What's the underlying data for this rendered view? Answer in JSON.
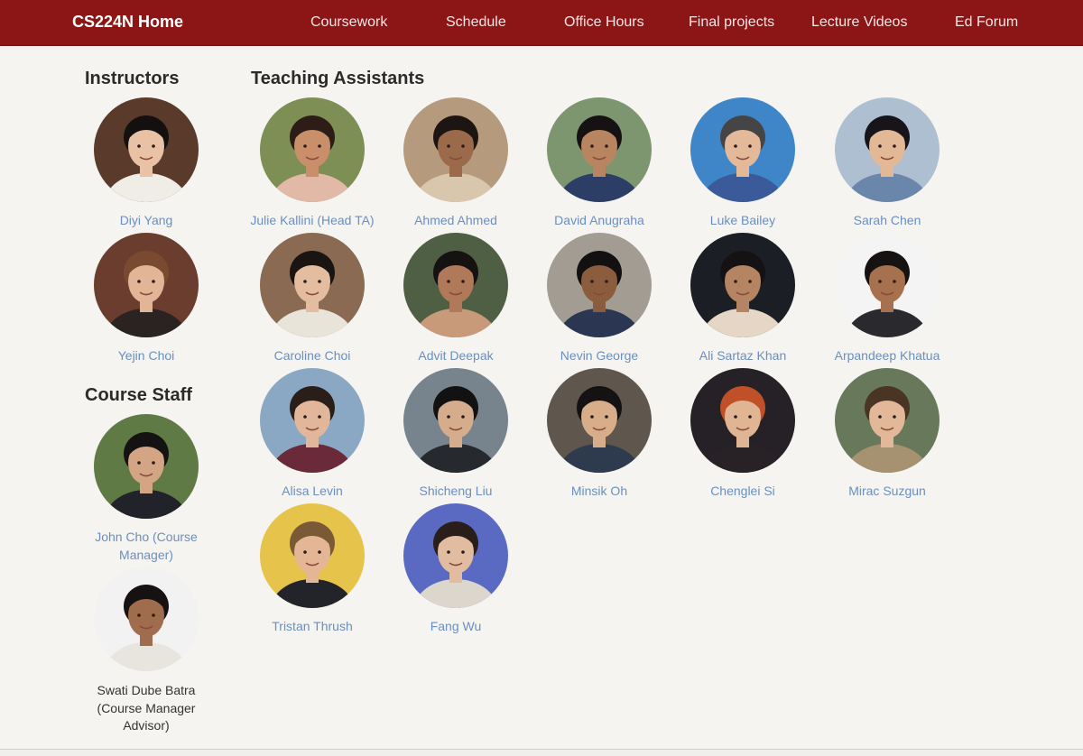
{
  "nav": {
    "brand": "CS224N Home",
    "links": [
      "Coursework",
      "Schedule",
      "Office Hours",
      "Final projects",
      "Lecture Videos",
      "Ed Forum"
    ]
  },
  "sections": {
    "instructors": "Instructors",
    "tas": "Teaching Assistants",
    "staff": "Course Staff"
  },
  "instructors": [
    {
      "name": "Diyi Yang",
      "palette": {
        "bg": "#5a3a2a",
        "skin": "#e9c2a6",
        "hair": "#141010",
        "shirt": "#f0ece6"
      }
    },
    {
      "name": "Yejin Choi",
      "palette": {
        "bg": "#6b3d2e",
        "skin": "#e2b596",
        "hair": "#7a4a30",
        "shirt": "#2a2322"
      }
    }
  ],
  "tas": [
    {
      "name": "Julie Kallini (Head TA)",
      "palette": {
        "bg": "#7d8f55",
        "skin": "#c98f6a",
        "hair": "#2d1d16",
        "shirt": "#e2b9a6"
      }
    },
    {
      "name": "Ahmed Ahmed",
      "palette": {
        "bg": "#b69a7e",
        "skin": "#9b6a4a",
        "hair": "#1d1512",
        "shirt": "#d9c7ad"
      }
    },
    {
      "name": "David Anugraha",
      "palette": {
        "bg": "#7e9670",
        "skin": "#b98560",
        "hair": "#161214",
        "shirt": "#2d3e66"
      }
    },
    {
      "name": "Luke Bailey",
      "palette": {
        "bg": "#3f86c9",
        "skin": "#e4b99a",
        "hair": "#454545",
        "shirt": "#3a5a9a"
      }
    },
    {
      "name": "Sarah Chen",
      "palette": {
        "bg": "#aebfd2",
        "skin": "#e2b896",
        "hair": "#17141a",
        "shirt": "#6a86aa"
      }
    },
    {
      "name": "Caroline Choi",
      "palette": {
        "bg": "#8a6a52",
        "skin": "#e4bca0",
        "hair": "#1a1412",
        "shirt": "#e8e4da"
      }
    },
    {
      "name": "Advit Deepak",
      "palette": {
        "bg": "#4f5f44",
        "skin": "#b07a5a",
        "hair": "#161212",
        "shirt": "#c99a7a"
      }
    },
    {
      "name": "Nevin George",
      "palette": {
        "bg": "#a29c92",
        "skin": "#8b5c3e",
        "hair": "#121010",
        "shirt": "#2a3652"
      }
    },
    {
      "name": "Ali Sartaz Khan",
      "palette": {
        "bg": "#1c1e26",
        "skin": "#b58462",
        "hair": "#141212",
        "shirt": "#e6d6c6"
      }
    },
    {
      "name": "Arpandeep Khatua",
      "palette": {
        "bg": "#f4f4f4",
        "skin": "#a7714f",
        "hair": "#161212",
        "shirt": "#2a2a2e"
      }
    },
    {
      "name": "Alisa Levin",
      "palette": {
        "bg": "#8aa8c4",
        "skin": "#e2b69a",
        "hair": "#2a1e18",
        "shirt": "#6a2a3a"
      }
    },
    {
      "name": "Shicheng Liu",
      "palette": {
        "bg": "#77848e",
        "skin": "#d6ad8c",
        "hair": "#131212",
        "shirt": "#26292e"
      }
    },
    {
      "name": "Minsik Oh",
      "palette": {
        "bg": "#5f574e",
        "skin": "#d8ad8a",
        "hair": "#141212",
        "shirt": "#2e3a4e"
      }
    },
    {
      "name": "Chenglei Si",
      "palette": {
        "bg": "#262126",
        "skin": "#e0b594",
        "hair": "#c05028",
        "shirt": "#282226"
      }
    },
    {
      "name": "Mirac Suzgun",
      "palette": {
        "bg": "#67795a",
        "skin": "#e2b898",
        "hair": "#4a3424",
        "shirt": "#a69270"
      }
    },
    {
      "name": "Tristan Thrush",
      "palette": {
        "bg": "#e6c44c",
        "skin": "#e4b696",
        "hair": "#7a5a36",
        "shirt": "#22242a"
      }
    },
    {
      "name": "Fang Wu",
      "palette": {
        "bg": "#5a6ac2",
        "skin": "#e2bca0",
        "hair": "#2a1e1a",
        "shirt": "#dcd6cc"
      }
    }
  ],
  "staff": [
    {
      "name": "John Cho (Course Manager)",
      "palette": {
        "bg": "#5f7a44",
        "skin": "#d4a584",
        "hair": "#141212",
        "shirt": "#22222a"
      }
    },
    {
      "name": "Swati Dube Batra (Course Manager Advisor)",
      "palette": {
        "bg": "#f2f2f2",
        "skin": "#a06c4e",
        "hair": "#161212",
        "shirt": "#e8e4de"
      }
    }
  ]
}
